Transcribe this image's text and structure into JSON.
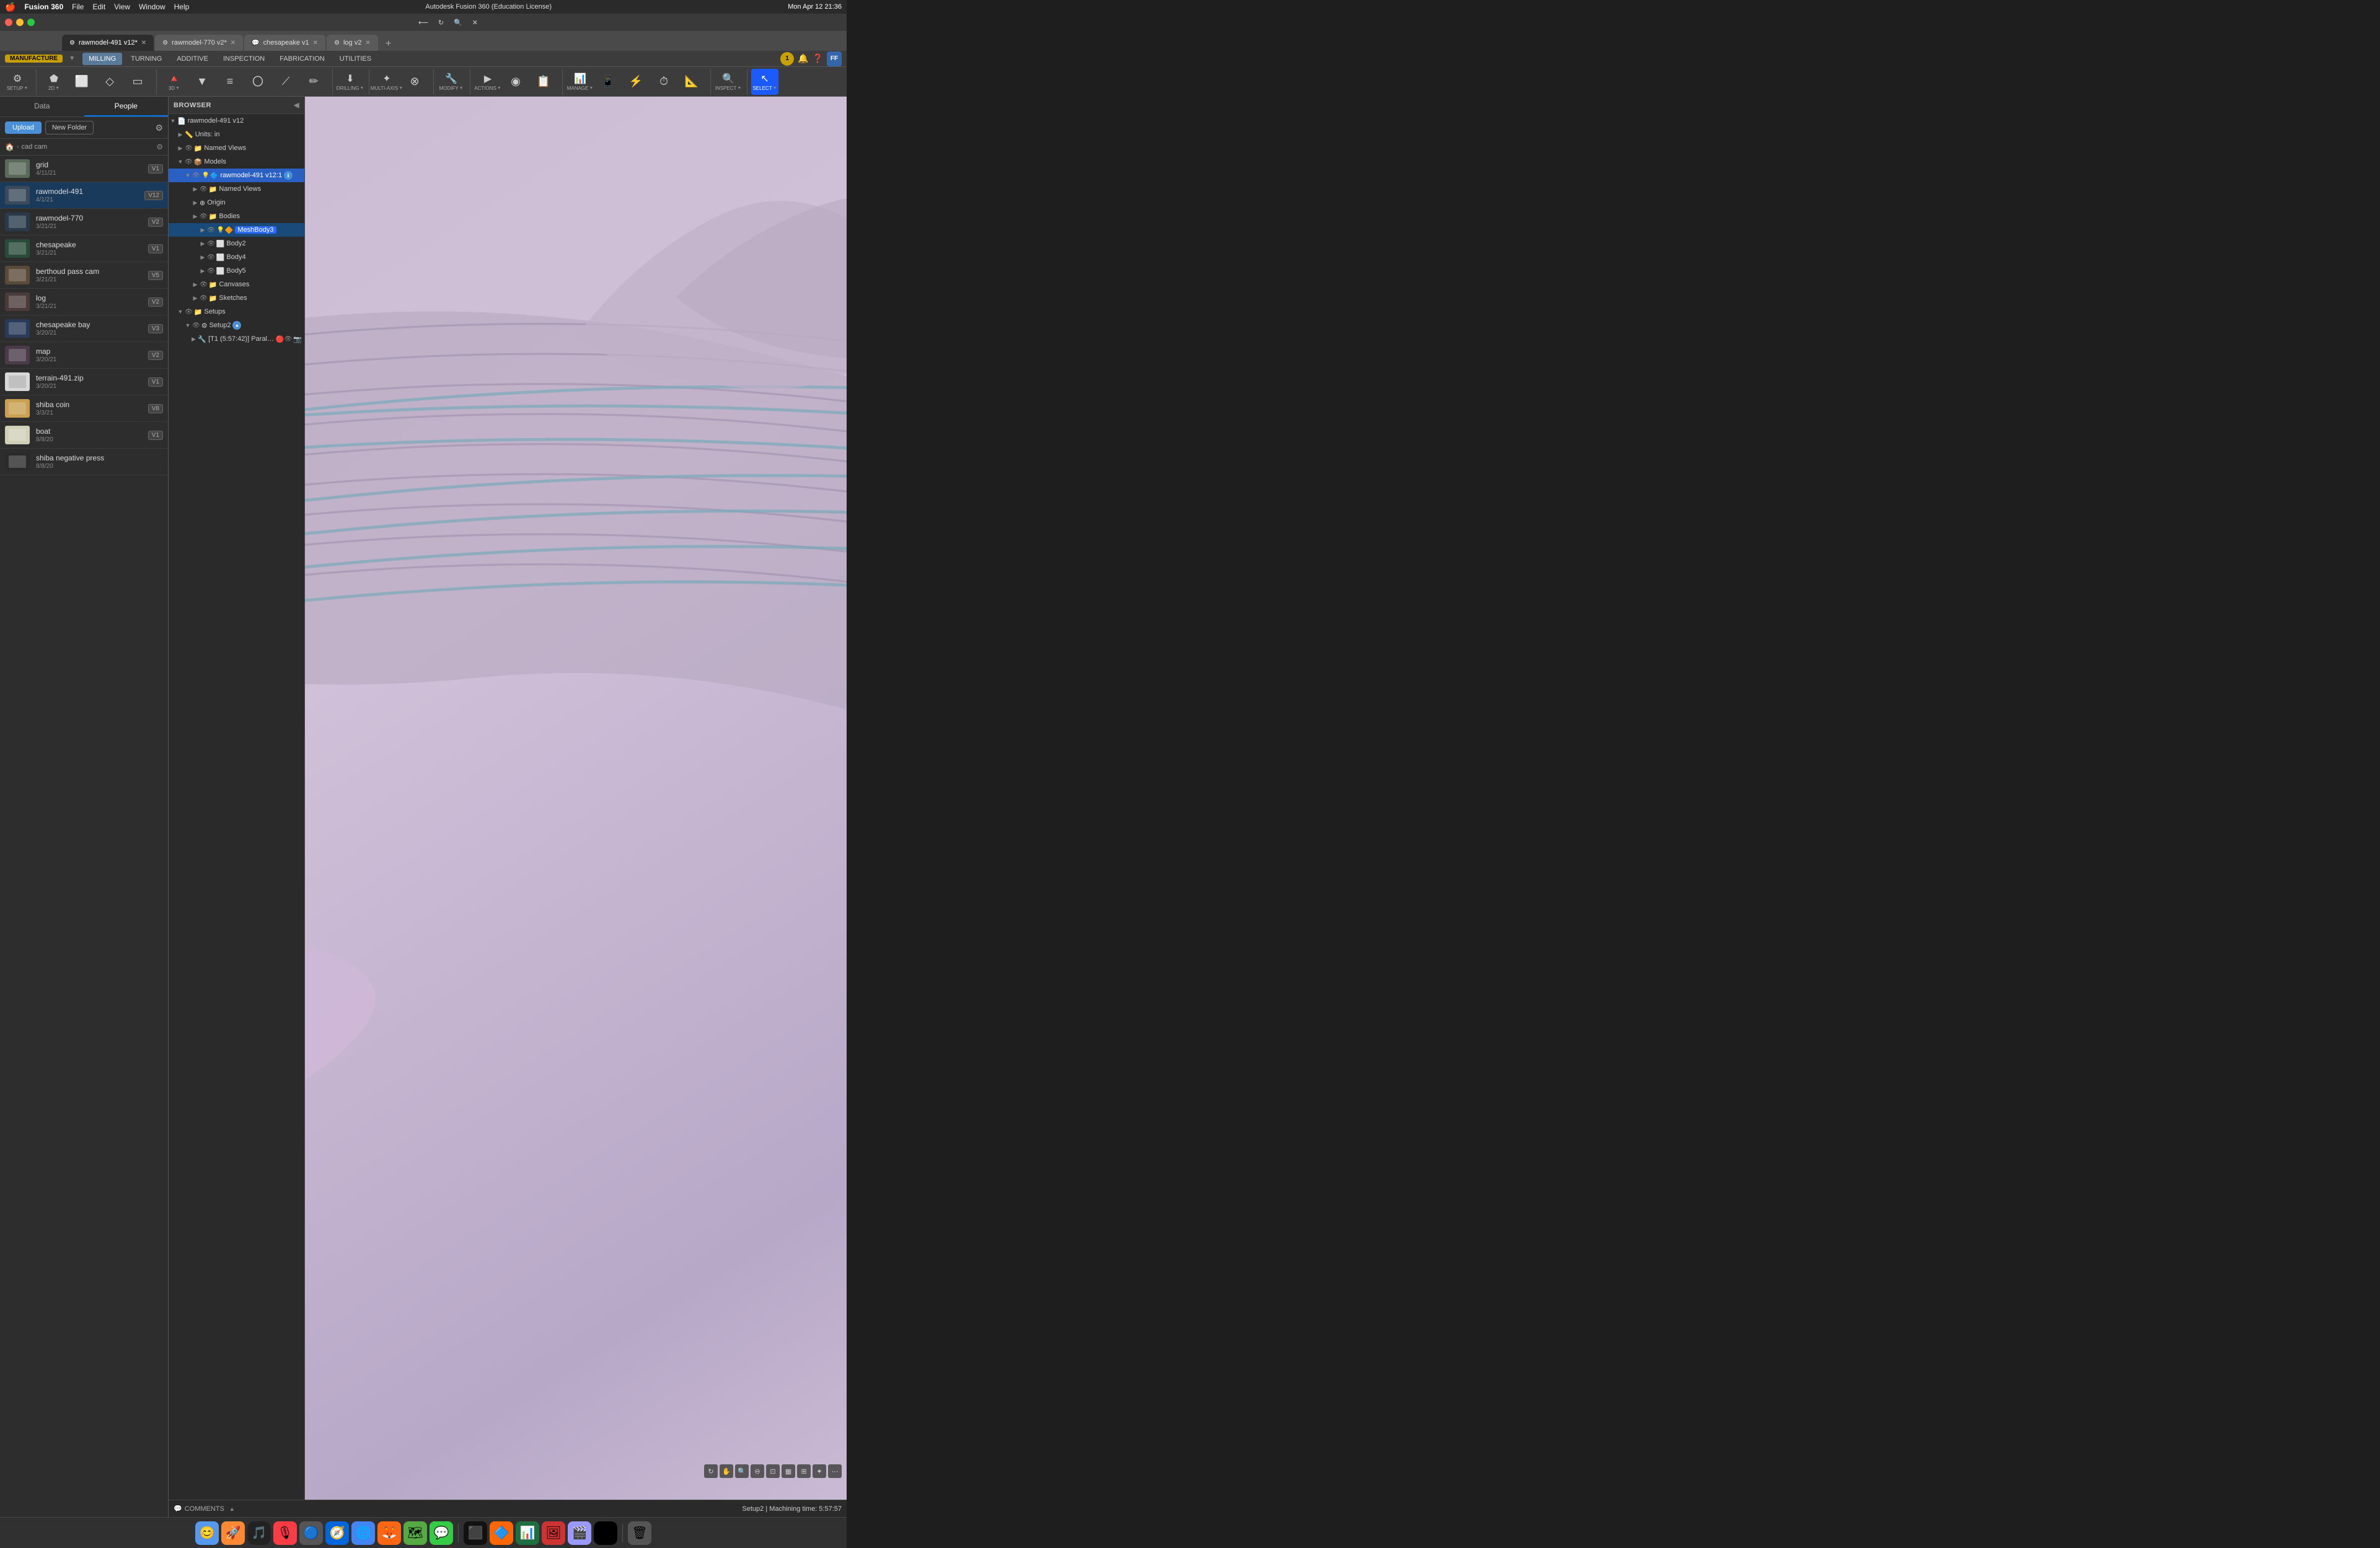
{
  "app": {
    "title": "Autodesk Fusion 360 (Education License)",
    "os": "macOS"
  },
  "menubar": {
    "apple": "🍎",
    "app_name": "Fusion 360",
    "menus": [
      "File",
      "Edit",
      "View",
      "Window",
      "Help"
    ],
    "time": "Mon Apr 12  21:36",
    "right_icons": [
      "⊞",
      "🕐",
      "🔋",
      "📶",
      "🔊"
    ]
  },
  "tabs": [
    {
      "id": "tab1",
      "label": "rawmodel-491 v12*",
      "active": true,
      "icon": "⚙"
    },
    {
      "id": "tab2",
      "label": "rawmodel-770 v2*",
      "active": false,
      "icon": "⚙"
    },
    {
      "id": "tab3",
      "label": "chesapeake v1",
      "active": false,
      "icon": "💬"
    },
    {
      "id": "tab4",
      "label": "log v2",
      "active": false,
      "icon": "⚙"
    }
  ],
  "sidebar": {
    "data_label": "Data",
    "people_label": "People",
    "active_tab": "People",
    "upload_label": "Upload",
    "new_folder_label": "New Folder",
    "breadcrumb": {
      "home": "🏠",
      "path": "cad cam"
    },
    "files": [
      {
        "name": "grid",
        "date": "4/11/21",
        "version": "V1",
        "thumb": "grid"
      },
      {
        "name": "rawmodel-491",
        "date": "4/1/21",
        "version": "V12",
        "thumb": "raw491",
        "selected": true
      },
      {
        "name": "rawmodel-770",
        "date": "3/21/21",
        "version": "V2",
        "thumb": "raw770"
      },
      {
        "name": "chesapeake",
        "date": "3/21/21",
        "version": "V1",
        "thumb": "chesapeake"
      },
      {
        "name": "berthoud pass cam",
        "date": "3/21/21",
        "version": "V5",
        "thumb": "berthoud"
      },
      {
        "name": "log",
        "date": "3/21/21",
        "version": "V2",
        "thumb": "log"
      },
      {
        "name": "chesapeake bay",
        "date": "3/20/21",
        "version": "V3",
        "thumb": "bay"
      },
      {
        "name": "map",
        "date": "3/20/21",
        "version": "V2",
        "thumb": "map"
      },
      {
        "name": "terrain-491.zip",
        "date": "3/20/21",
        "version": "V1",
        "thumb": "terrain"
      },
      {
        "name": "shiba coin",
        "date": "3/3/21",
        "version": "V8",
        "thumb": "shiba"
      },
      {
        "name": "boat",
        "date": "8/8/20",
        "version": "V1",
        "thumb": "boat"
      },
      {
        "name": "shiba negative press",
        "date": "8/8/20",
        "version": "",
        "thumb": "neg"
      }
    ]
  },
  "toolbar": {
    "workspace_label": "MANUFACTURE",
    "dropdown_arrow": "▼",
    "tabs": [
      "MILLING",
      "TURNING",
      "ADDITIVE",
      "INSPECTION",
      "FABRICATION",
      "UTILITIES"
    ],
    "active_tab": "MILLING",
    "setup_label": "SETUP",
    "setup_btn": "▼",
    "icon_groups": [
      {
        "name": "2d",
        "label": "2D ▼",
        "icons": []
      },
      {
        "name": "3d",
        "label": "3D ▼",
        "icons": []
      },
      {
        "name": "drilling",
        "label": "DRILLING ▼",
        "icons": []
      },
      {
        "name": "multi-axis",
        "label": "MULTI-AXIS ▼",
        "icons": []
      },
      {
        "name": "modify",
        "label": "MODIFY ▼",
        "icons": []
      },
      {
        "name": "actions",
        "label": "ACTIONS ▼",
        "icons": []
      },
      {
        "name": "manage",
        "label": "MANAGE ▼",
        "icons": []
      },
      {
        "name": "inspect",
        "label": "INSPECT ▼",
        "icons": []
      },
      {
        "name": "select",
        "label": "SELECT ▼",
        "icons": []
      }
    ]
  },
  "browser": {
    "title": "BROWSER",
    "tree": [
      {
        "id": "root",
        "label": "rawmodel-491 v12",
        "depth": 0,
        "expanded": true,
        "type": "file",
        "icon": "📄"
      },
      {
        "id": "units",
        "label": "Units: in",
        "depth": 1,
        "expanded": false,
        "type": "units",
        "icon": "📏"
      },
      {
        "id": "namedviews",
        "label": "Named Views",
        "depth": 1,
        "expanded": false,
        "type": "folder",
        "icon": "📁"
      },
      {
        "id": "models",
        "label": "Models",
        "depth": 1,
        "expanded": true,
        "type": "folder",
        "icon": "📦"
      },
      {
        "id": "rawmodel491v12",
        "label": "rawmodel-491 v12:1",
        "depth": 2,
        "expanded": true,
        "type": "component",
        "icon": "🔷",
        "highlighted": true
      },
      {
        "id": "namedviews2",
        "label": "Named Views",
        "depth": 3,
        "expanded": false,
        "type": "folder",
        "icon": "📁"
      },
      {
        "id": "origin",
        "label": "Origin",
        "depth": 3,
        "expanded": false,
        "type": "origin",
        "icon": "⊕"
      },
      {
        "id": "bodies",
        "label": "Bodies",
        "depth": 3,
        "expanded": true,
        "type": "folder",
        "icon": "📁"
      },
      {
        "id": "meshbody3",
        "label": "MeshBody3",
        "depth": 4,
        "expanded": false,
        "type": "mesh",
        "icon": "🔶",
        "selected": true
      },
      {
        "id": "body2",
        "label": "Body2",
        "depth": 4,
        "expanded": false,
        "type": "body",
        "icon": "⬜"
      },
      {
        "id": "body4",
        "label": "Body4",
        "depth": 4,
        "expanded": false,
        "type": "body",
        "icon": "⬜"
      },
      {
        "id": "body5",
        "label": "Body5",
        "depth": 4,
        "expanded": false,
        "type": "body",
        "icon": "⬜"
      },
      {
        "id": "canvases",
        "label": "Canvases",
        "depth": 3,
        "expanded": false,
        "type": "folder",
        "icon": "📁"
      },
      {
        "id": "sketches",
        "label": "Sketches",
        "depth": 3,
        "expanded": false,
        "type": "folder",
        "icon": "📁"
      },
      {
        "id": "setups",
        "label": "Setups",
        "depth": 1,
        "expanded": true,
        "type": "folder",
        "icon": "📁"
      },
      {
        "id": "setup2",
        "label": "Setup2",
        "depth": 2,
        "expanded": true,
        "type": "setup",
        "icon": "⚙",
        "badge": "●"
      },
      {
        "id": "toolpath1",
        "label": "[T1 (5:57:42)] Paral…",
        "depth": 3,
        "expanded": false,
        "type": "toolpath",
        "icon": "🔧",
        "error": "!"
      }
    ]
  },
  "comments": {
    "label": "COMMENTS",
    "collapse_icon": "▲"
  },
  "status": {
    "text": "Setup2 | Machining time: 5:57:57"
  },
  "dock": {
    "icons": [
      {
        "name": "finder",
        "emoji": "😊",
        "color": "#5599ee"
      },
      {
        "name": "launchpad",
        "emoji": "🚀",
        "color": "#ee8833"
      },
      {
        "name": "music",
        "emoji": "🎵",
        "color": "#fc3c44"
      },
      {
        "name": "podcasts",
        "emoji": "🎙",
        "color": "#8a3aff"
      },
      {
        "name": "safari",
        "emoji": "🧭",
        "color": "#0066dd"
      },
      {
        "name": "chrome",
        "emoji": "🌐",
        "color": "#4285f4"
      },
      {
        "name": "firefox",
        "emoji": "🦊",
        "color": "#ff6611"
      },
      {
        "name": "maps",
        "emoji": "🗺",
        "color": "#55aa44"
      },
      {
        "name": "messages",
        "emoji": "💬",
        "color": "#33cc44"
      },
      {
        "name": "calendar",
        "emoji": "📅",
        "color": "#ff3b30"
      },
      {
        "name": "terminal",
        "emoji": "⬛",
        "color": "#111111"
      },
      {
        "name": "fusion360",
        "emoji": "🔷",
        "color": "#ff6600"
      },
      {
        "name": "excel",
        "emoji": "📊",
        "color": "#1d6f42"
      },
      {
        "name": "photos",
        "emoji": "🖼",
        "color": "#eebb33"
      },
      {
        "name": "premiere",
        "emoji": "🎬",
        "color": "#9999ff"
      },
      {
        "name": "autodesk",
        "emoji": "🅐",
        "color": "#000"
      }
    ]
  }
}
